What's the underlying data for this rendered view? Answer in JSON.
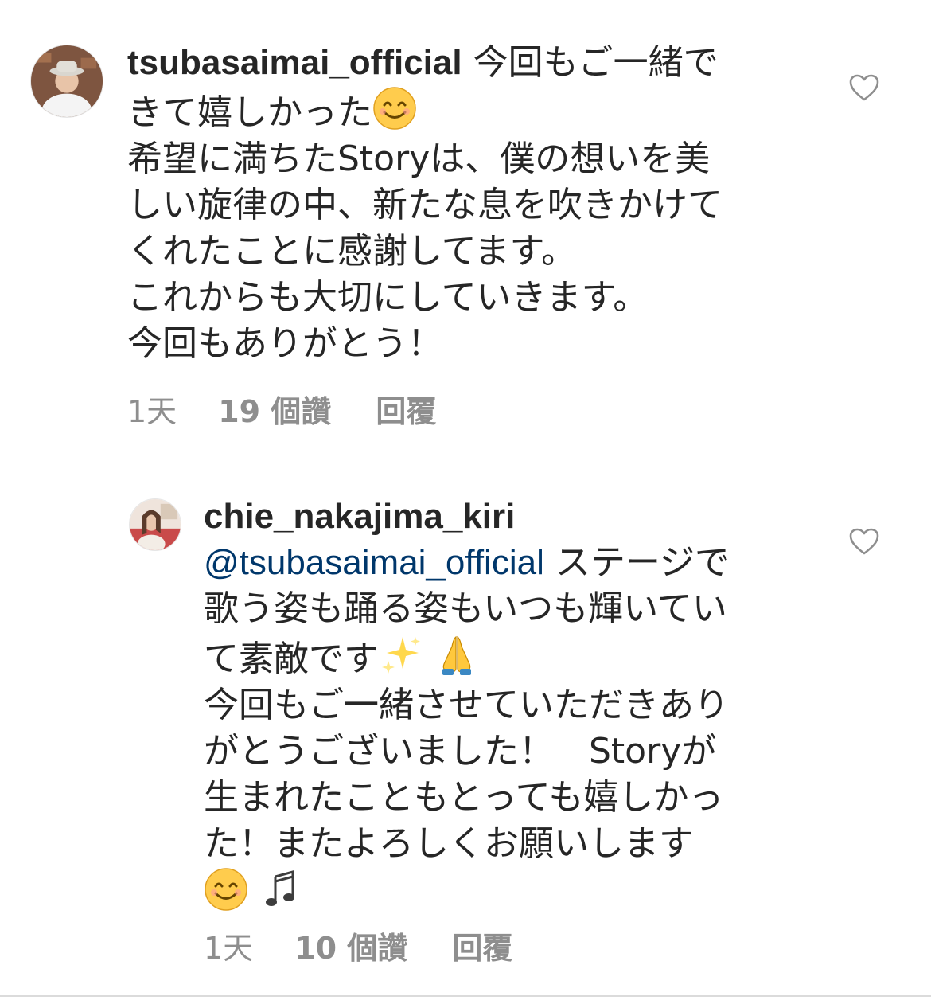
{
  "comments": [
    {
      "username": "tsubasaimai_official",
      "text_line1": " 今回もご一緒で",
      "text_line2": "きて嬉しかった",
      "text_rest": "希望に満ちたStoryは、僕の想いを美\nしい旋律の中、新たな息を吹きかけて\nくれたことに感謝してます。\nこれからも大切にしていきます。\n今回もありがとう！",
      "emoji_1": "smiling-face-emoji",
      "age": "1天",
      "likes": "19 個讚",
      "reply": "回覆",
      "like_icon": "heart-outline-icon"
    },
    {
      "username": "chie_nakajima_kiri",
      "mention": "@tsubasaimai_official",
      "text_line1": " ステージで",
      "text_line2": "歌う姿も踊る姿もいつも輝いてい\nて素敵です",
      "text_rest": "今回もご一緒させていただきあり\nがとうございました！　Storyが\n生まれたこともとっても嬉しかっ\nた！またよろしくお願いします",
      "emoji_1": "sparkles-emoji",
      "emoji_2": "folded-hands-emoji",
      "emoji_3": "smiling-face-emoji",
      "emoji_4": "musical-notes-emoji",
      "age": "1天",
      "likes": "10 個讚",
      "reply": "回覆",
      "like_icon": "heart-outline-icon"
    }
  ],
  "colors": {
    "text": "#262626",
    "meta": "#8e8e8e",
    "mention": "#00376b",
    "divider": "#dbdbdb"
  }
}
